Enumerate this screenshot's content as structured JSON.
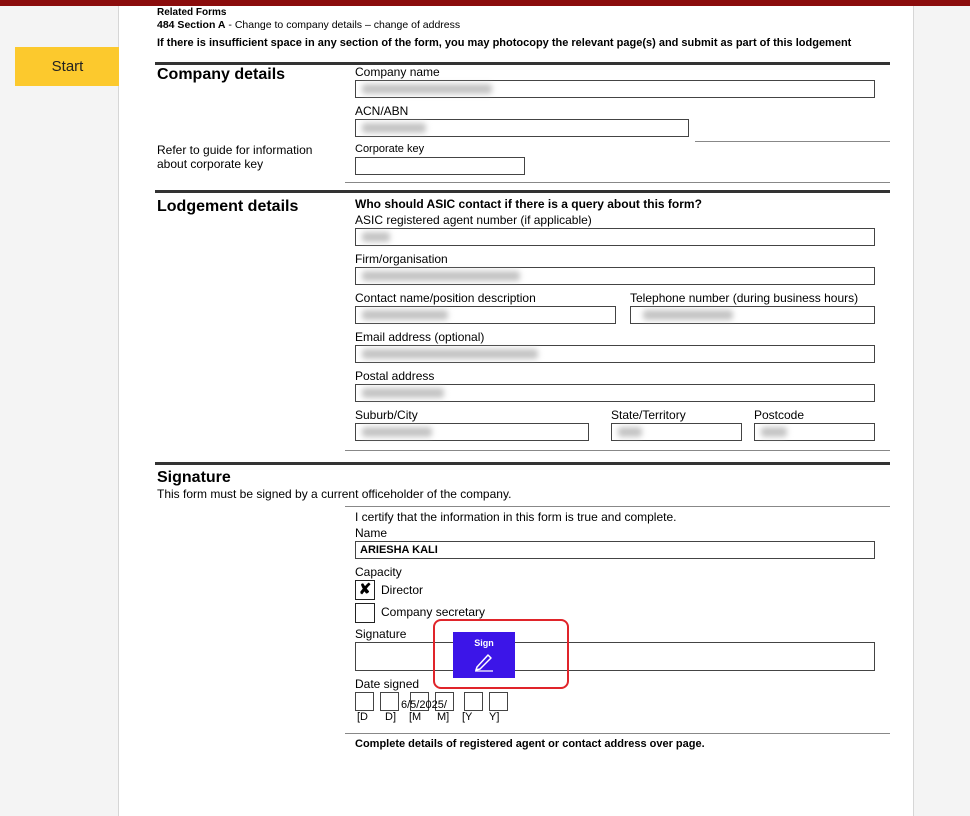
{
  "toolbar": {
    "start_label": "Start"
  },
  "header": {
    "related_forms": "Related Forms",
    "section_bold": "484 Section A",
    "section_rest": " - Change to company details – change of address",
    "notice": "If there is insufficient space in any section of the form, you may photocopy the relevant page(s) and submit as part of this lodgement"
  },
  "company": {
    "heading": "Company details",
    "name_label": "Company name",
    "acn_label": "ACN/ABN",
    "guide_text_1": "Refer to guide for information",
    "guide_text_2": "about corporate key",
    "corp_key_label": "Corporate key"
  },
  "lodgement": {
    "heading": "Lodgement details",
    "question": "Who should ASIC contact if there is a query about this form?",
    "agent_label": "ASIC registered agent number (if applicable)",
    "firm_label": "Firm/organisation",
    "contact_label": "Contact name/position description",
    "phone_label": "Telephone number (during business hours)",
    "email_label": "Email address (optional)",
    "postal_label": "Postal address",
    "suburb_label": "Suburb/City",
    "state_label": "State/Territory",
    "postcode_label": "Postcode"
  },
  "signature": {
    "heading": "Signature",
    "subtitle": "This form must be signed by a current officeholder of the company.",
    "certify": "I certify that the information in this form is true and complete.",
    "name_label": "Name",
    "name_value": "ARIESHA KALI",
    "capacity_label": "Capacity",
    "director_label": "Director",
    "director_checked": true,
    "director_mark": "✘",
    "secretary_label": "Company secretary",
    "secretary_checked": false,
    "signature_label": "Signature",
    "sign_button_label": "Sign",
    "date_label": "Date signed",
    "date_value": "6/5/2025",
    "date_value_with_sep": "6/5/2025/",
    "date_hints": [
      "[D",
      "D]",
      "[M",
      "M]",
      "[Y",
      "Y]"
    ],
    "footer_note": "Complete details of registered agent or contact address over page."
  },
  "colors": {
    "top_bar": "#8b0d0d",
    "start_button": "#fcc92d",
    "sign_button": "#3c15e8",
    "highlight_border": "#e0242a"
  }
}
